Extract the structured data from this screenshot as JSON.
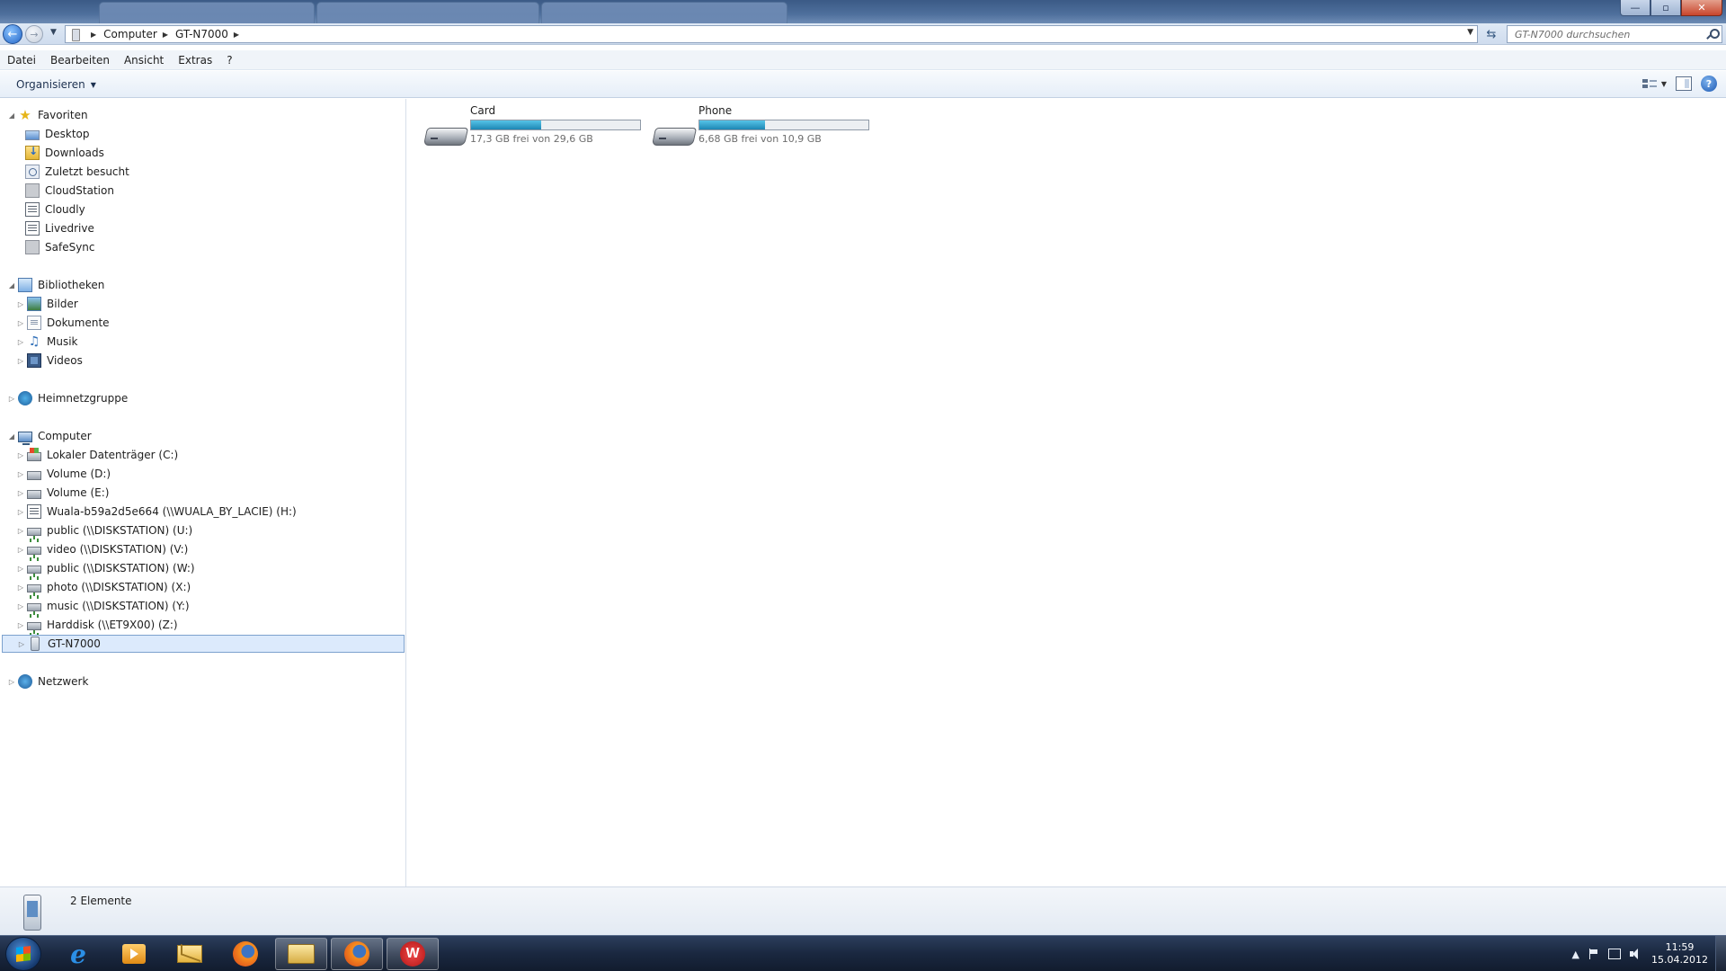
{
  "window": {
    "controls": {
      "minimize": "—",
      "maximize": "▫",
      "close": "✕"
    }
  },
  "address": {
    "breadcrumbs": [
      "Computer",
      "GT-N7000"
    ],
    "search_placeholder": "GT-N7000 durchsuchen"
  },
  "menu": [
    "Datei",
    "Bearbeiten",
    "Ansicht",
    "Extras",
    "?"
  ],
  "command_bar": {
    "organize_label": "Organisieren"
  },
  "nav": {
    "favorites": {
      "label": "Favoriten",
      "items": [
        "Desktop",
        "Downloads",
        "Zuletzt besucht",
        "CloudStation",
        "Cloudly",
        "Livedrive",
        "SafeSync"
      ]
    },
    "libraries": {
      "label": "Bibliotheken",
      "items": [
        "Bilder",
        "Dokumente",
        "Musik",
        "Videos"
      ]
    },
    "homegroup": {
      "label": "Heimnetzgruppe"
    },
    "computer": {
      "label": "Computer",
      "items": [
        "Lokaler Datenträger (C:)",
        "Volume (D:)",
        "Volume (E:)",
        "Wuala-b59a2d5e664 (\\\\WUALA_BY_LACIE) (H:)",
        "public (\\\\DISKSTATION) (U:)",
        "video (\\\\DISKSTATION) (V:)",
        "public (\\\\DISKSTATION) (W:)",
        "photo (\\\\DISKSTATION) (X:)",
        "music (\\\\DISKSTATION) (Y:)",
        "Harddisk (\\\\ET9X00) (Z:)",
        "GT-N7000"
      ],
      "selected": "GT-N7000"
    },
    "network": {
      "label": "Netzwerk"
    }
  },
  "content": {
    "drives": [
      {
        "name": "Card",
        "free_text": "17,3 GB frei von 29,6 GB",
        "used_fraction": 0.416
      },
      {
        "name": "Phone",
        "free_text": "6,68 GB frei von 10,9 GB",
        "used_fraction": 0.387
      }
    ]
  },
  "details": {
    "count_text": "2 Elemente"
  },
  "taskbar": {
    "apps": [
      "internet-explorer",
      "media-player",
      "mail",
      "firefox",
      "windows-explorer",
      "firefox",
      "w-app"
    ],
    "tray": {
      "chevron": "▲"
    },
    "clock": {
      "time": "11:59",
      "date": "15.04.2012"
    }
  },
  "colors": {
    "accent": "#2a8fc4",
    "selection": "#dceafc",
    "taskbar": "#1a2840"
  }
}
